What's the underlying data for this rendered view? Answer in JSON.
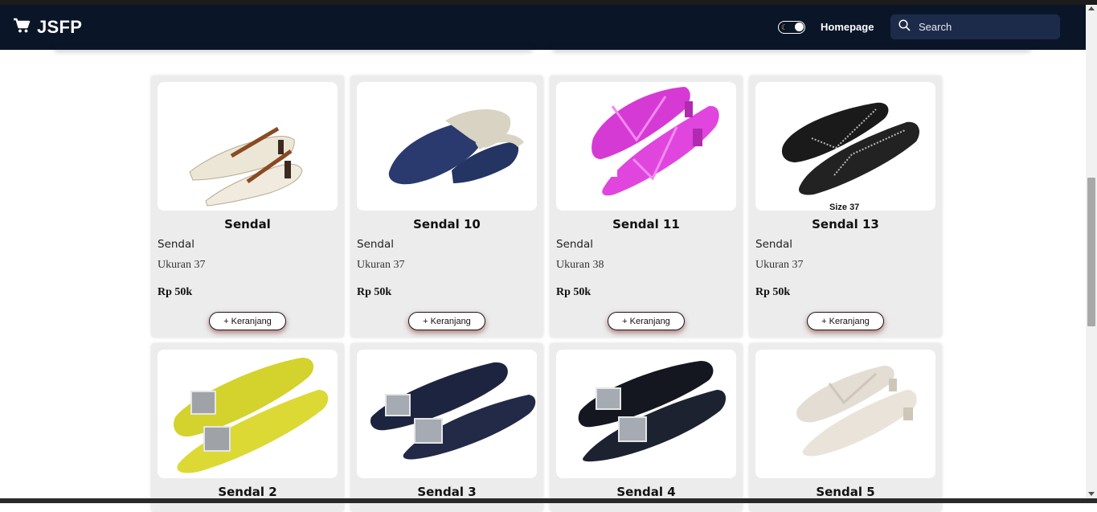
{
  "navbar": {
    "brand": "JSFP",
    "nav_link": "Homepage",
    "search_placeholder": "Search"
  },
  "colors": {
    "navbar_bg": "#0b1528",
    "search_bg": "#1d2b4a",
    "card_bg": "#ececec"
  },
  "products": [
    {
      "name": "Sendal",
      "category": "Sendal",
      "size": "Ukuran 37",
      "price": "Rp 50k",
      "cart_label": "+ Keranjang",
      "image_icon": "cream-strap-heel-shoe"
    },
    {
      "name": "Sendal 10",
      "category": "Sendal",
      "size": "Ukuran 37",
      "price": "Rp 50k",
      "cart_label": "+ Keranjang",
      "image_icon": "navy-knit-mule"
    },
    {
      "name": "Sendal 11",
      "category": "Sendal",
      "size": "Ukuran 38",
      "price": "Rp 50k",
      "cart_label": "+ Keranjang",
      "image_icon": "pink-flip-flop-heel"
    },
    {
      "name": "Sendal 13",
      "category": "Sendal",
      "size": "Ukuran 37",
      "price": "Rp 50k",
      "cart_label": "+ Keranjang",
      "image_icon": "black-thong-sandal",
      "image_caption": "Size 37"
    },
    {
      "name": "Sendal 2",
      "image_icon": "yellow-jewel-slingback"
    },
    {
      "name": "Sendal 3",
      "image_icon": "navy-jewel-slingback"
    },
    {
      "name": "Sendal 4",
      "image_icon": "black-jewel-flat"
    },
    {
      "name": "Sendal 5",
      "image_icon": "cream-thong-heel"
    }
  ]
}
